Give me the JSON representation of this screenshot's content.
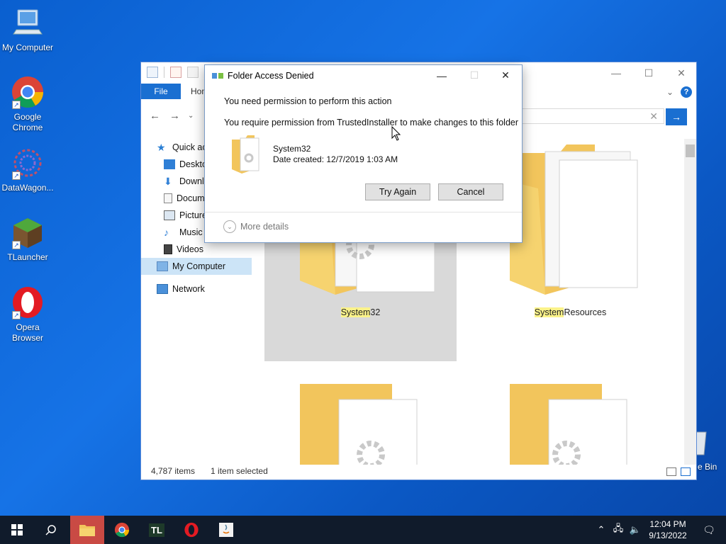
{
  "desktop": {
    "icons": [
      {
        "label": "My Computer"
      },
      {
        "label": "Google Chrome"
      },
      {
        "label": "DataWagon..."
      },
      {
        "label": "TLauncher"
      },
      {
        "label": "Opera Browser"
      }
    ],
    "recycle_bin_partial": "e Bin"
  },
  "explorer": {
    "ribbon": {
      "file_tab": "File",
      "home_tab": "Hom"
    },
    "sidebar": [
      {
        "label": "Quick ac",
        "icon": "star-icon"
      },
      {
        "label": "Deskto",
        "icon": "desktop-icon"
      },
      {
        "label": "Downlo",
        "icon": "download-icon"
      },
      {
        "label": "Docum",
        "icon": "document-icon"
      },
      {
        "label": "Picture",
        "icon": "picture-icon"
      },
      {
        "label": "Music",
        "icon": "music-icon"
      },
      {
        "label": "Videos",
        "icon": "video-icon"
      },
      {
        "label": "My Computer",
        "icon": "computer-icon",
        "selected": true
      },
      {
        "label": "Network",
        "icon": "network-icon"
      }
    ],
    "folders": [
      {
        "label_hl": "System",
        "label_rest": "32",
        "selected": true
      },
      {
        "label_hl": "System",
        "label_rest": "Resources",
        "selected": false
      }
    ],
    "status": {
      "items": "4,787 items",
      "selected": "1 item selected"
    }
  },
  "dialog": {
    "title": "Folder Access Denied",
    "heading": "You need permission to perform this action",
    "message": "You require permission from TrustedInstaller to make changes to this folder",
    "folder_name": "System32",
    "date_created": "Date created: 12/7/2019 1:03 AM",
    "try_again": "Try Again",
    "cancel": "Cancel",
    "more_details": "More details"
  },
  "taskbar": {
    "time": "12:04 PM",
    "date": "9/13/2022",
    "tl_label": "TL"
  },
  "colors": {
    "accent": "#1a6fd1",
    "taskbar": "#101b2b",
    "folder": "#f6d06e"
  }
}
